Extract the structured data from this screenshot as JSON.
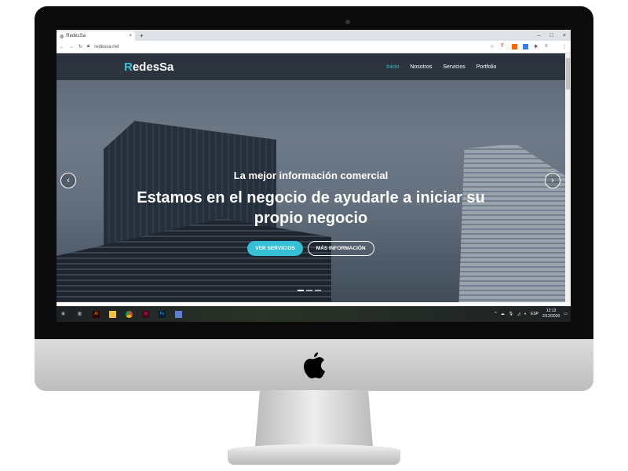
{
  "browser": {
    "tab_title": "RedesSa",
    "url": "redessa.net",
    "new_tab": "+",
    "close": "×",
    "minimize": "–",
    "maximize": "□",
    "close_window": "×"
  },
  "site": {
    "logo_first": "R",
    "logo_rest": "edesSa",
    "nav": [
      {
        "label": "Inicio",
        "active": true
      },
      {
        "label": "Nosotros"
      },
      {
        "label": "Servicios"
      },
      {
        "label": "Portfolio"
      }
    ],
    "hero": {
      "subtitle": "La mejor información comercial",
      "title": "Estamos en el negocio de ayudarle a iniciar su propio negocio",
      "primary_button": "VER SERVICIOS",
      "secondary_button": "MÁS INFORMACIÓN",
      "slide_count": 3,
      "active_slide": 1
    },
    "accent": "#36c0d6"
  },
  "taskbar": {
    "apps": [
      "windows",
      "task-view",
      "Ai",
      "explorer",
      "chrome",
      "Id",
      "Ps",
      "app"
    ],
    "language": "ESP",
    "time": "12:13",
    "date": "2/12/2020"
  }
}
